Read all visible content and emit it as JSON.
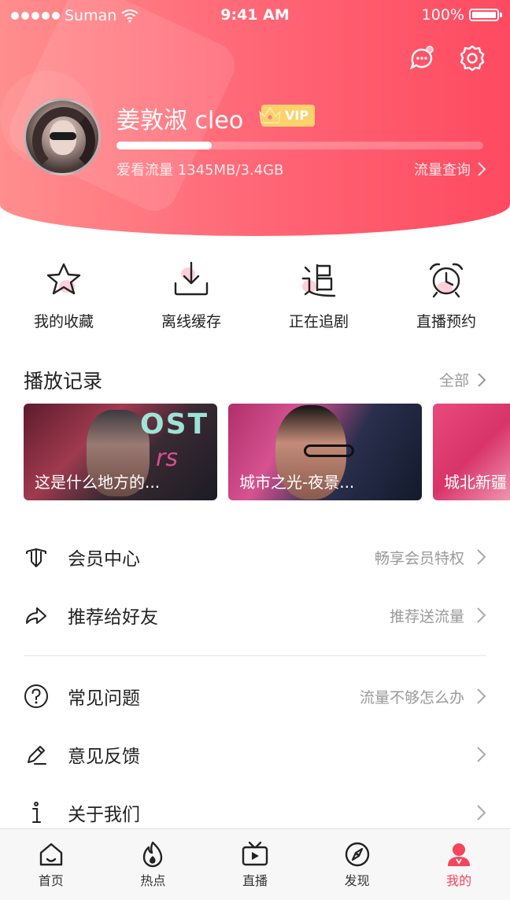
{
  "status_bar": {
    "carrier": "Suman",
    "time": "9:41 AM",
    "battery": "100%"
  },
  "profile": {
    "name": "姜敦淑 cleo",
    "vip_label": "VIP",
    "traffic_usage": "爱看流量 1345MB/3.4GB",
    "traffic_fraction": 0.26,
    "traffic_query": "流量查询"
  },
  "quick_actions": [
    {
      "label": "我的收藏",
      "icon": "star-icon"
    },
    {
      "label": "离线缓存",
      "icon": "download-icon"
    },
    {
      "label": "正在追剧",
      "icon": "follow-icon"
    },
    {
      "label": "直播预约",
      "icon": "alarm-clock-icon"
    }
  ],
  "history": {
    "title": "播放记录",
    "more": "全部",
    "items": [
      {
        "caption": "这是什么地方的..."
      },
      {
        "caption": "城市之光-夜景..."
      },
      {
        "caption": "城北新疆"
      }
    ]
  },
  "menu": [
    {
      "label": "会员中心",
      "hint": "畅享会员特权",
      "icon": "member-icon"
    },
    {
      "label": "推荐给好友",
      "hint": "推荐送流量",
      "icon": "share-icon"
    },
    {
      "label": "常见问题",
      "hint": "流量不够怎么办",
      "icon": "question-icon"
    },
    {
      "label": "意见反馈",
      "hint": "",
      "icon": "pencil-icon"
    },
    {
      "label": "关于我们",
      "hint": "",
      "icon": "info-icon"
    }
  ],
  "tabs": [
    {
      "label": "首页",
      "icon": "home-icon"
    },
    {
      "label": "热点",
      "icon": "flame-icon"
    },
    {
      "label": "直播",
      "icon": "tv-icon"
    },
    {
      "label": "发现",
      "icon": "compass-icon"
    },
    {
      "label": "我的",
      "icon": "profile-icon",
      "active": true
    }
  ],
  "colors": {
    "brand_red": "#f5455c",
    "header_start": "#ff8e8e",
    "header_end": "#fe4a61",
    "vip_gold": "#fbd26b"
  }
}
